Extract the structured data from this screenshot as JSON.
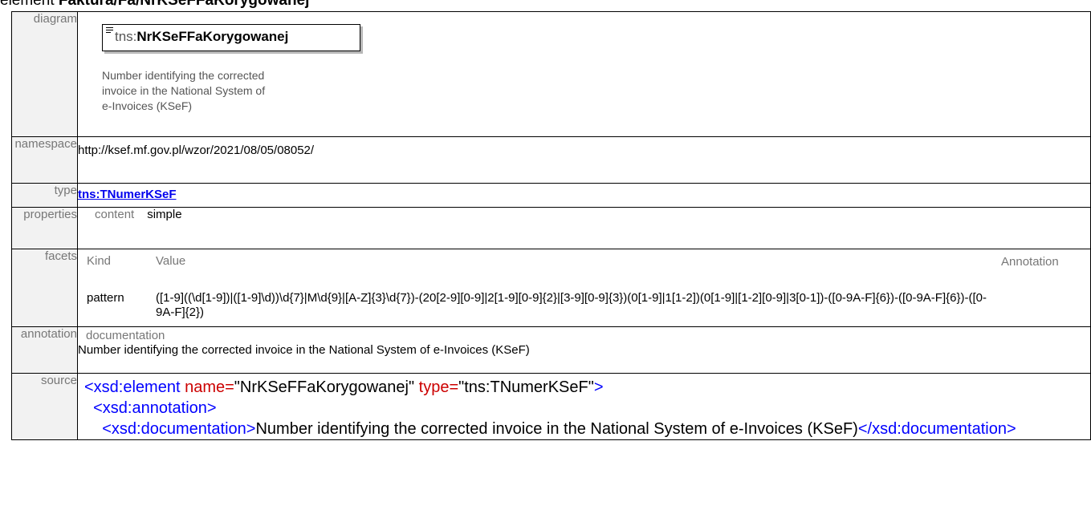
{
  "heading": {
    "prefix": "element ",
    "path": "Faktura/Fa/NrKSeFFaKorygowanej"
  },
  "labels": {
    "diagram": "diagram",
    "namespace": "namespace",
    "type": "type",
    "properties": "properties",
    "facets": "facets",
    "annotation": "annotation",
    "source": "source"
  },
  "diagram": {
    "ns_prefix": "tns:",
    "name": "NrKSeFFaKorygowanej",
    "doc_lines": [
      "Number identifying the corrected",
      "invoice in the National System of",
      "e-Invoices (KSeF)"
    ]
  },
  "namespace": "http://ksef.mf.gov.pl/wzor/2021/08/05/08052/",
  "type_link": "tns:TNumerKSeF",
  "properties": {
    "content_label": "content",
    "content_value": "simple"
  },
  "facets": {
    "kind_header": "Kind",
    "value_header": "Value",
    "annotation_header": "Annotation",
    "kind": "pattern",
    "value": "([1-9]((\\d[1-9])|([1-9]\\d))\\d{7}|M\\d{9}|[A-Z]{3}\\d{7})-(20[2-9][0-9]|2[1-9][0-9]{2}|[3-9][0-9]{3})(0[1-9]|1[1-2])(0[1-9]|[1-2][0-9]|3[0-1])-([0-9A-F]{6})-([0-9A-F]{6})-([0-9A-F]{2})"
  },
  "annotation": {
    "label": "documentation",
    "text": "Number identifying the corrected invoice in the National System of e-Invoices (KSeF)"
  },
  "source": {
    "open_tag": "<xsd:element",
    "name_attr": "name=",
    "name_val": "\"NrKSeFFaKorygowanej\"",
    "type_attr": "type=",
    "type_val": "\"tns:TNumerKSeF\"",
    "close_bracket": ">",
    "annotation_open": "<xsd:annotation>",
    "doc_open": "<xsd:documentation>",
    "doc_text": "Number identifying the corrected invoice in the National System of e-Invoices (KSeF)",
    "doc_close": "</xsd:documentation>"
  }
}
